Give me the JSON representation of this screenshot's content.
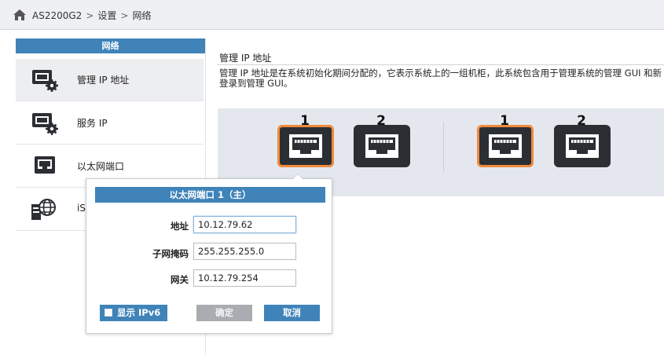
{
  "breadcrumb": {
    "device": "AS2200G2",
    "section": "设置",
    "page": "网络"
  },
  "sidebar": {
    "header": "网络",
    "items": [
      {
        "label": "管理 IP 地址",
        "icon": "management-ip-icon",
        "active": true
      },
      {
        "label": "服务 IP",
        "icon": "service-ip-icon",
        "active": false
      },
      {
        "label": "以太网端口",
        "icon": "ethernet-port-icon",
        "active": false
      },
      {
        "label": "iS",
        "icon": "iscsi-globe-icon",
        "active": false
      }
    ]
  },
  "main": {
    "title": "管理 IP 地址",
    "description": "管理 IP 地址是在系统初始化期间分配的，它表示系统上的一组机柜，此系统包含用于管理系统的管理 GUI 和新登录到管理 GUI。",
    "ports": [
      {
        "number": "1",
        "selected": true
      },
      {
        "number": "2",
        "selected": false
      },
      {
        "number": "1",
        "selected": true
      },
      {
        "number": "2",
        "selected": false
      }
    ]
  },
  "popup": {
    "title": "以太网端口 1（主）",
    "address_label": "地址",
    "address_value": "10.12.79.62",
    "subnet_label": "子网掩码",
    "subnet_value": "255.255.255.0",
    "gateway_label": "网关",
    "gateway_value": "10.12.79.254",
    "show_ipv6_label": "显示 IPv6",
    "show_ipv6_checked": false,
    "ok_label": "确定",
    "cancel_label": "取消"
  },
  "colors": {
    "accent": "#3f83b8",
    "selected_port_border": "#ef8a3e",
    "port_body": "#2b2f33",
    "disabled_button": "#a9acb0"
  }
}
